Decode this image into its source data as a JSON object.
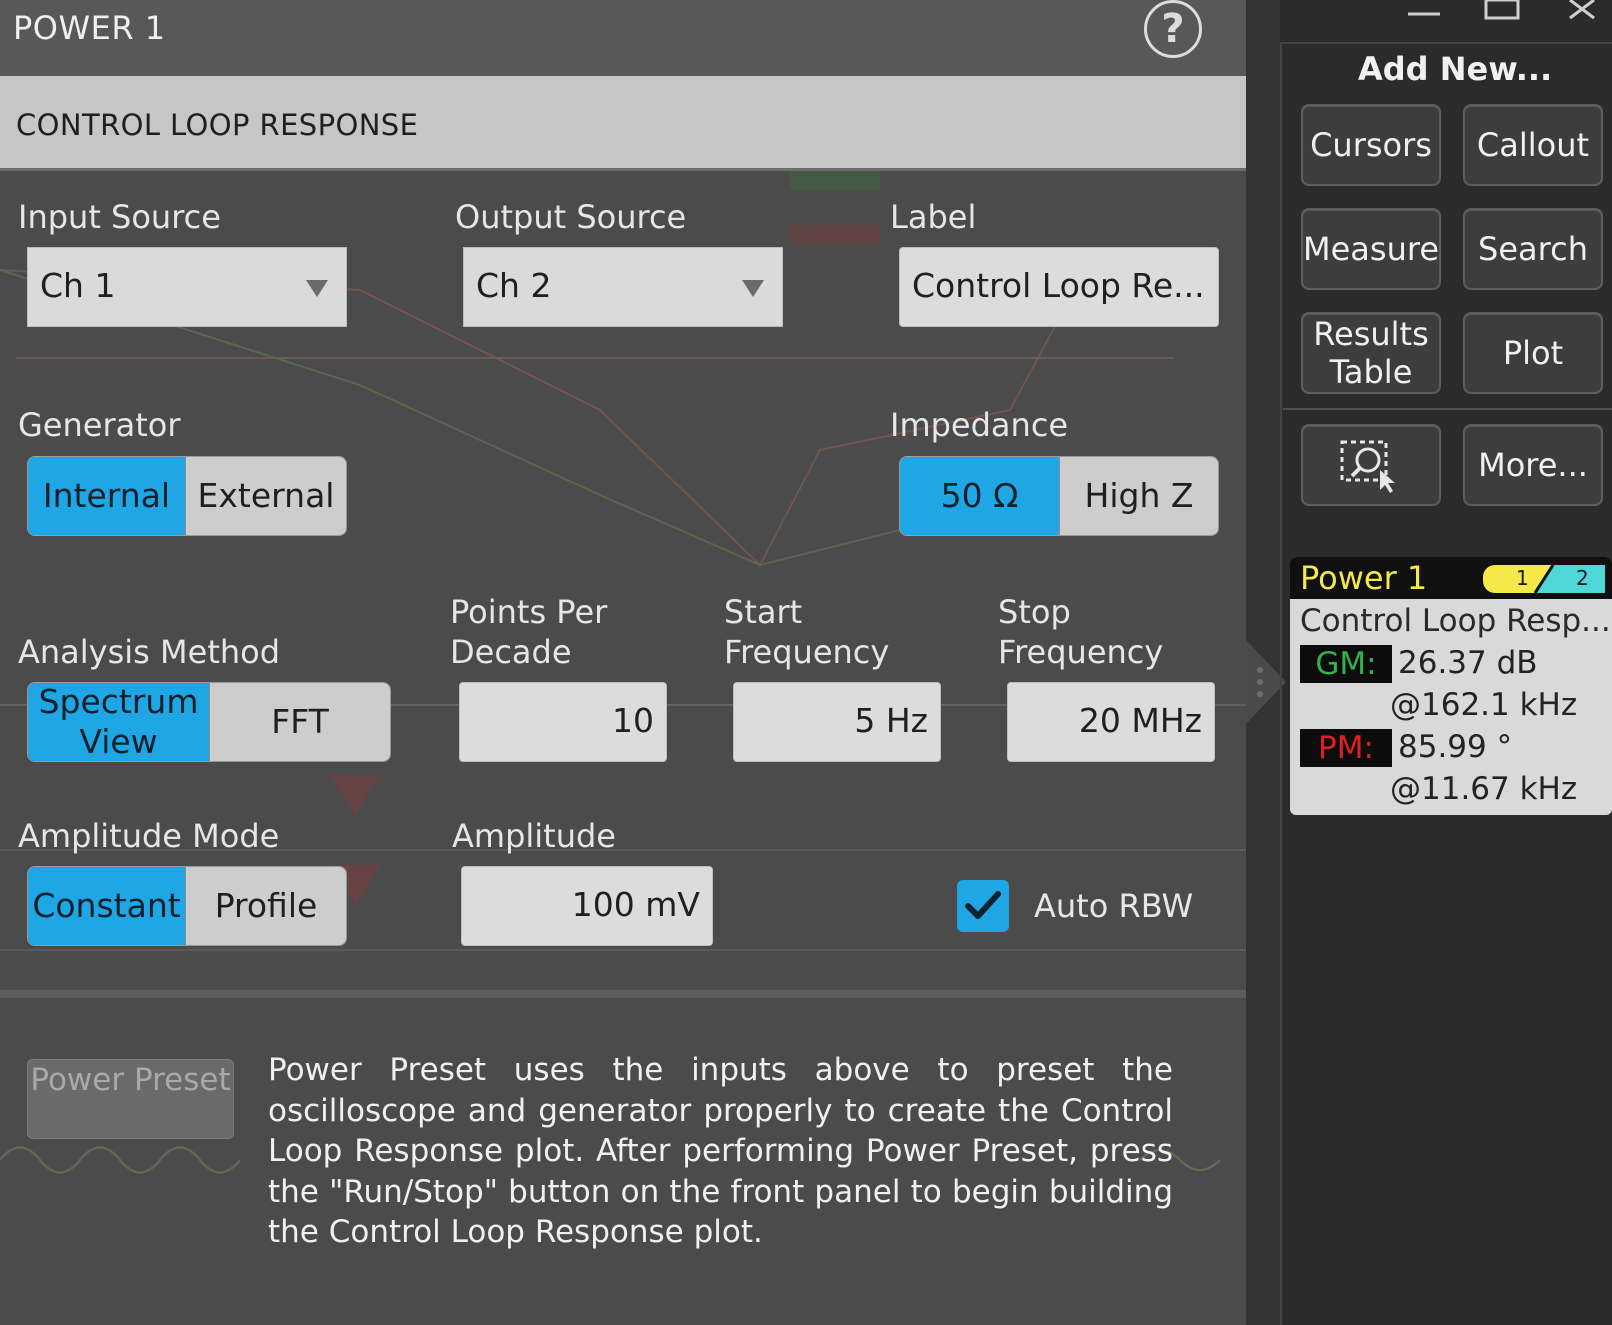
{
  "dialog": {
    "title": "POWER 1",
    "help_glyph": "?",
    "section_title": "CONTROL LOOP RESPONSE"
  },
  "form": {
    "input_source": {
      "label": "Input Source",
      "value": "Ch 1"
    },
    "output_source": {
      "label": "Output Source",
      "value": "Ch 2"
    },
    "label_field": {
      "label": "Label",
      "value": "Control Loop Re..."
    },
    "generator": {
      "label": "Generator",
      "options": [
        "Internal",
        "External"
      ],
      "selected": "Internal"
    },
    "impedance": {
      "label": "Impedance",
      "options": [
        "50 Ω",
        "High Z"
      ],
      "selected": "50 Ω"
    },
    "analysis_method": {
      "label": "Analysis Method",
      "options": [
        "Spectrum View",
        "FFT"
      ],
      "selected": "Spectrum View"
    },
    "points_per_decade": {
      "label": "Points Per Decade",
      "value": "10"
    },
    "start_frequency": {
      "label": "Start Frequency",
      "value": "5 Hz"
    },
    "stop_frequency": {
      "label": "Stop Frequency",
      "value": "20 MHz"
    },
    "amplitude_mode": {
      "label": "Amplitude Mode",
      "options": [
        "Constant",
        "Profile"
      ],
      "selected": "Constant"
    },
    "amplitude": {
      "label": "Amplitude",
      "value": "100 mV"
    },
    "auto_rbw": {
      "label": "Auto RBW",
      "checked": true
    },
    "power_preset": {
      "button_label": "Power Preset",
      "description": "Power Preset uses the inputs above to preset the oscilloscope and generator properly to create the Control Loop Response plot. After performing Power Preset, press the \"Run/Stop\" button on the front panel to begin building the Control Loop Response plot."
    }
  },
  "right_panel": {
    "add_new_title": "Add New...",
    "buttons": [
      "Cursors",
      "Callout",
      "Measure",
      "Search",
      "Results Table",
      "Plot",
      "zoom-select-icon",
      "More..."
    ],
    "window_controls": [
      "minimize-icon",
      "maximize-icon",
      "close-icon"
    ]
  },
  "badge": {
    "title": "Power 1",
    "chip_1": "1",
    "chip_2": "2",
    "name": "Control Loop Resp...",
    "gm_key": "GM:",
    "gm_value": "26.37 dB",
    "gm_at": "@162.1 kHz",
    "pm_key": "PM:",
    "pm_value": "85.99 °",
    "pm_at": "@11.67 kHz"
  },
  "colors": {
    "accent": "#1ea7e4",
    "badge_title": "#f5e94a",
    "gm_green": "#2fb34a",
    "pm_red": "#e02020"
  }
}
